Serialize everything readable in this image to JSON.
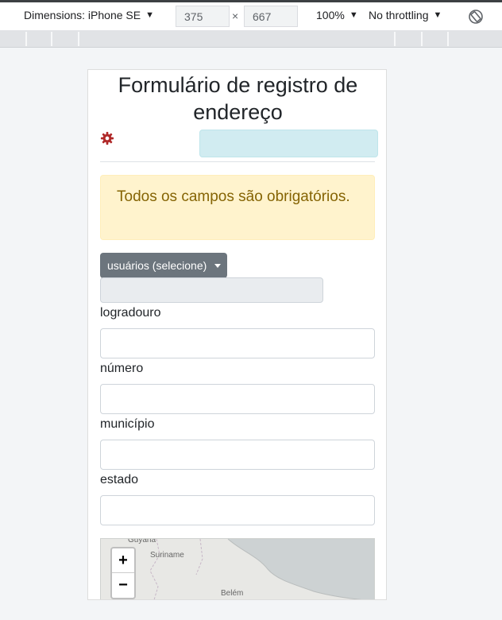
{
  "devtools": {
    "dimensions_label": "Dimensions: iPhone SE",
    "width": "375",
    "height": "667",
    "times": "×",
    "zoom": "100%",
    "throttling": "No throttling"
  },
  "page": {
    "title": "Formulário de registro de endereço",
    "alert": "Todos os campos são obrigatórios.",
    "users_dropdown": "usuários (selecione)",
    "fields": [
      {
        "label": "logradouro"
      },
      {
        "label": "número"
      },
      {
        "label": "município"
      },
      {
        "label": "estado"
      }
    ]
  },
  "map": {
    "zoom_in": "+",
    "zoom_out": "−",
    "places": [
      "Guyana",
      "Suriname",
      "Belém"
    ]
  },
  "colors": {
    "gear": "#b02a2a",
    "alert_bg": "#fff3cd",
    "alert_text": "#856404",
    "info_bg": "#d1ecf1",
    "dropdown_bg": "#6c757d"
  }
}
